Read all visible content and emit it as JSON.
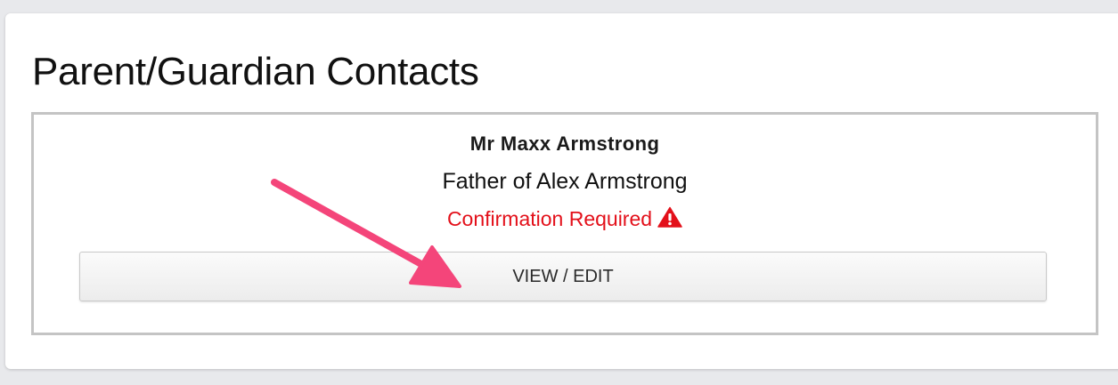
{
  "panel": {
    "title": "Parent/Guardian Contacts"
  },
  "contact": {
    "name": "Mr Maxx Armstrong",
    "relation": "Father of Alex Armstrong",
    "status": "Confirmation Required",
    "status_icon": "warning-triangle-icon",
    "status_color": "#e3101a",
    "action_label": "VIEW / EDIT"
  },
  "annotation": {
    "arrow_color": "#f4457a",
    "arrow_icon": "pointer-arrow"
  }
}
